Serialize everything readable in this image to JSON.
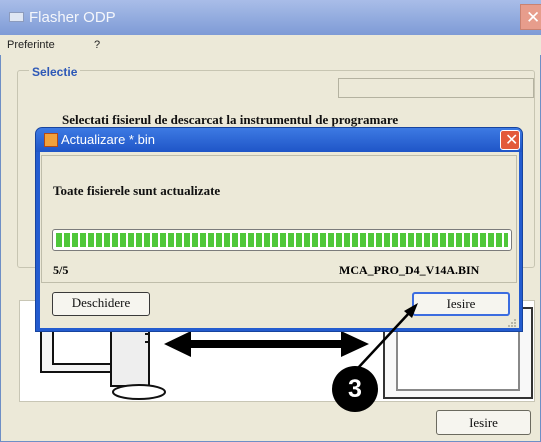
{
  "main_window": {
    "title": "Flasher ODP",
    "menu": [
      "Preferinte",
      "?"
    ],
    "group_legend": "Selectie",
    "instruction": "Selectati fisierul de descarcat la instrumentul de programare",
    "exit_label": "Iesire"
  },
  "dialog": {
    "title": "Actualizare *.bin",
    "message": "Toate fisierele sunt actualizate",
    "progress_percent": 100,
    "count": "5/5",
    "filename": "MCA_PRO_D4_V14A.BIN",
    "open_label": "Deschidere",
    "exit_label": "Iesire"
  },
  "callout": {
    "number": "3"
  },
  "icons": {
    "main_app": "app-window-icon",
    "dialog_app": "refresh-icon",
    "close": "close-icon",
    "grip": "resize-grip-icon"
  },
  "colors": {
    "dialog_titlebar": "#245ccf",
    "progress_fill": "#4fc73a",
    "main_titlebar": "#7e9bd6",
    "legend_text": "#2d58b7"
  }
}
